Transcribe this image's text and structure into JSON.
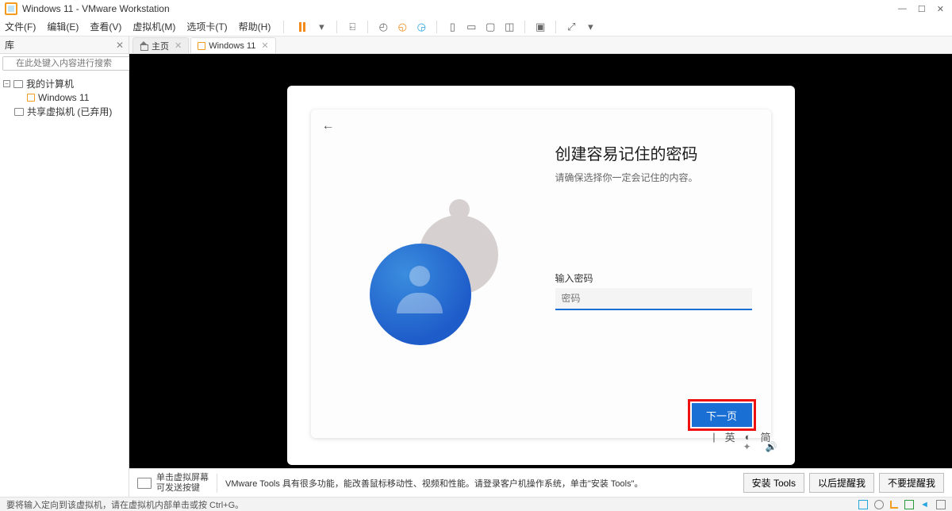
{
  "window": {
    "title": "Windows 11 - VMware Workstation"
  },
  "menus": {
    "file": "文件(F)",
    "edit": "编辑(E)",
    "view": "查看(V)",
    "vm": "虚拟机(M)",
    "tabs": "选项卡(T)",
    "help": "帮助(H)"
  },
  "sidebar": {
    "title": "库",
    "search_placeholder": "在此处键入内容进行搜索",
    "items": [
      {
        "label": "我的计算机"
      },
      {
        "label": "Windows 11"
      },
      {
        "label": "共享虚拟机 (已弃用)"
      }
    ]
  },
  "tabs": [
    {
      "label": "主页",
      "active": false
    },
    {
      "label": "Windows 11",
      "active": true
    }
  ],
  "oobe": {
    "title": "创建容易记住的密码",
    "subtitle": "请确保选择你一定会记住的内容。",
    "field_label": "输入密码",
    "placeholder": "密码",
    "next": "下一页",
    "ime": {
      "mode": "英",
      "alt": "简"
    }
  },
  "infobar": {
    "hint_line1": "单击虚拟屏幕",
    "hint_line2": "可发送按键",
    "tools_note": "VMware Tools 具有很多功能，能改善鼠标移动性、视频和性能。请登录客户机操作系统，单击\"安装 Tools\"。",
    "btn_install": "安装 Tools",
    "btn_later": "以后提醒我",
    "btn_never": "不要提醒我"
  },
  "statusbar": {
    "text": "要将输入定向到该虚拟机，请在虚拟机内部单击或按 Ctrl+G。"
  }
}
